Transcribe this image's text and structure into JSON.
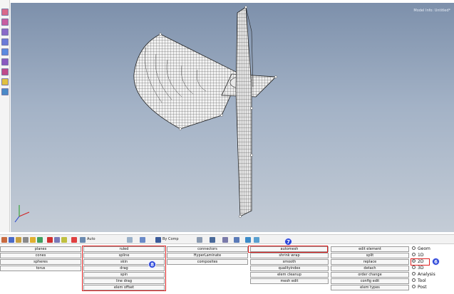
{
  "viewport": {
    "model_info": "Model Info: Untitled*"
  },
  "toolbar": {
    "auto_label": "Auto",
    "by_comp_label": "By Comp"
  },
  "panel_columns": [
    {
      "items": [
        "planes",
        "cones",
        "spheres",
        "torus"
      ]
    },
    {
      "items": [
        "ruled",
        "spline",
        "skin",
        "drag",
        "spin",
        "line drag",
        "elem offset"
      ]
    },
    {
      "items": [
        "connectors",
        "HyperLaminate",
        "composites"
      ]
    },
    {
      "items": [
        "automesh",
        "shrink wrap",
        "smooth",
        "qualityindex",
        "elem cleanup",
        "mesh edit"
      ]
    },
    {
      "items": [
        "edit element",
        "split",
        "replace",
        "detach",
        "order change",
        "config edit",
        "elem types"
      ]
    }
  ],
  "page_selector": {
    "options": [
      "Geom",
      "1D",
      "2D",
      "3D",
      "Analysis",
      "Tool",
      "Post"
    ],
    "selected": "2D"
  },
  "annotations": {
    "marker_7": "7",
    "marker_8": "8",
    "marker_6": "6"
  },
  "colors": {
    "highlight_red": "#e02020",
    "marker_blue": "#2a46d8",
    "viewport_top": "#7d90ab",
    "viewport_bottom": "#c4ccd6"
  }
}
